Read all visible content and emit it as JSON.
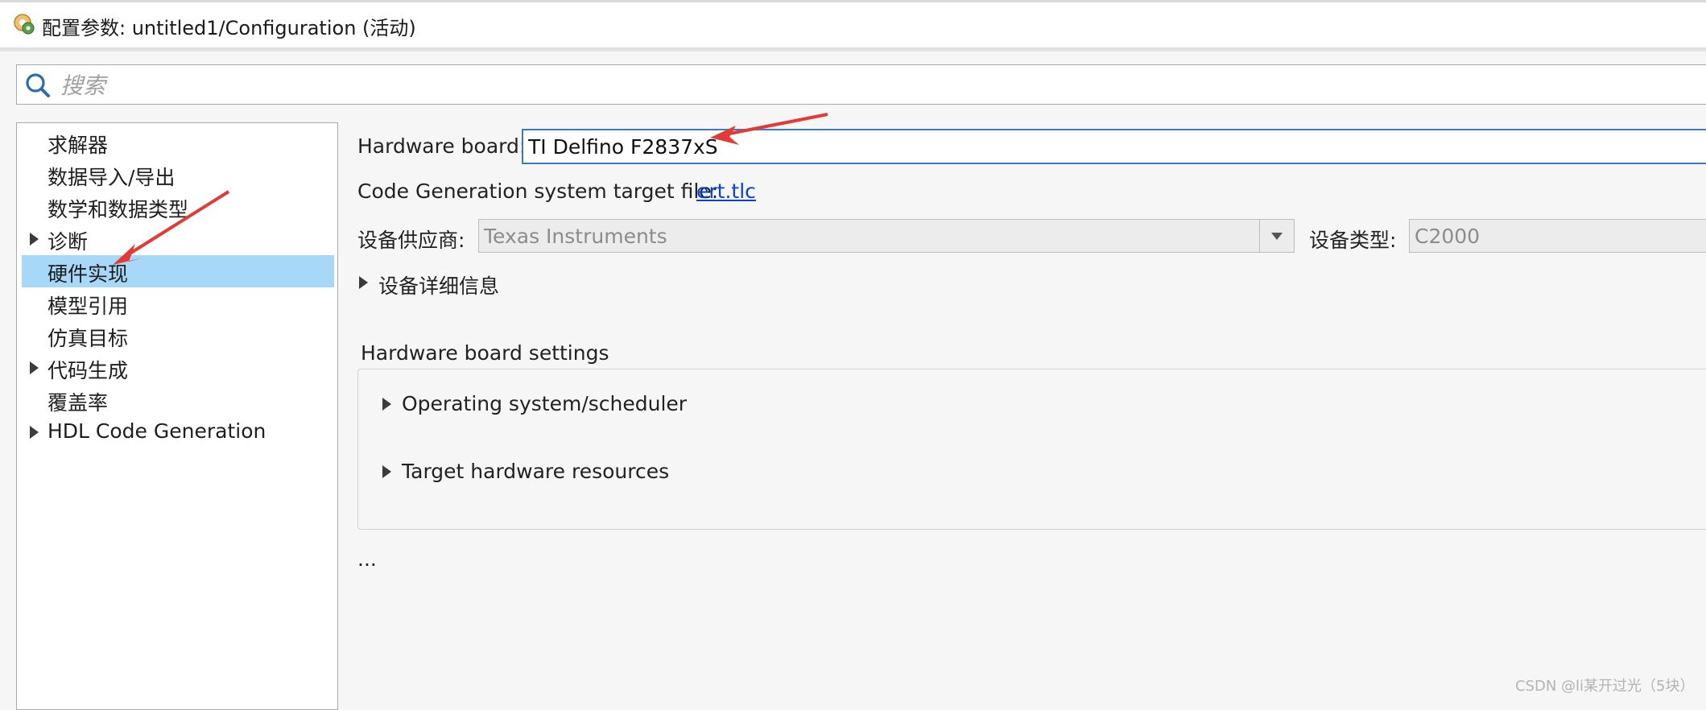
{
  "window": {
    "title": "配置参数: untitled1/Configuration (活动)"
  },
  "search": {
    "placeholder": "搜索"
  },
  "sidebar": {
    "items": [
      {
        "label": "求解器",
        "expandable": false,
        "selected": false
      },
      {
        "label": "数据导入/导出",
        "expandable": false,
        "selected": false
      },
      {
        "label": "数学和数据类型",
        "expandable": false,
        "selected": false
      },
      {
        "label": "诊断",
        "expandable": true,
        "selected": false
      },
      {
        "label": "硬件实现",
        "expandable": false,
        "selected": true
      },
      {
        "label": "模型引用",
        "expandable": false,
        "selected": false
      },
      {
        "label": "仿真目标",
        "expandable": false,
        "selected": false
      },
      {
        "label": "代码生成",
        "expandable": true,
        "selected": false
      },
      {
        "label": "覆盖率",
        "expandable": false,
        "selected": false
      },
      {
        "label": "HDL Code Generation",
        "expandable": true,
        "selected": false
      }
    ]
  },
  "main": {
    "hardware_board_label": "Hardware board:",
    "hardware_board_value": "TI Delfino F2837xS",
    "codegen_label": "Code Generation system target file:",
    "codegen_link": "ert.tlc",
    "vendor_label": "设备供应商:",
    "vendor_value": "Texas Instruments",
    "device_type_label": "设备类型:",
    "device_type_value": "C2000",
    "device_details": "设备详细信息",
    "board_settings_title": "Hardware board settings",
    "board_settings_items": [
      "Operating system/scheduler",
      "Target hardware resources"
    ],
    "ellipsis": "..."
  },
  "watermark": "CSDN @li某开过光（5块）",
  "colors": {
    "selection": "#a7d8f7",
    "link": "#0b3fe0",
    "focus_border": "#3c79c4",
    "annotation_arrow": "#e53935"
  }
}
